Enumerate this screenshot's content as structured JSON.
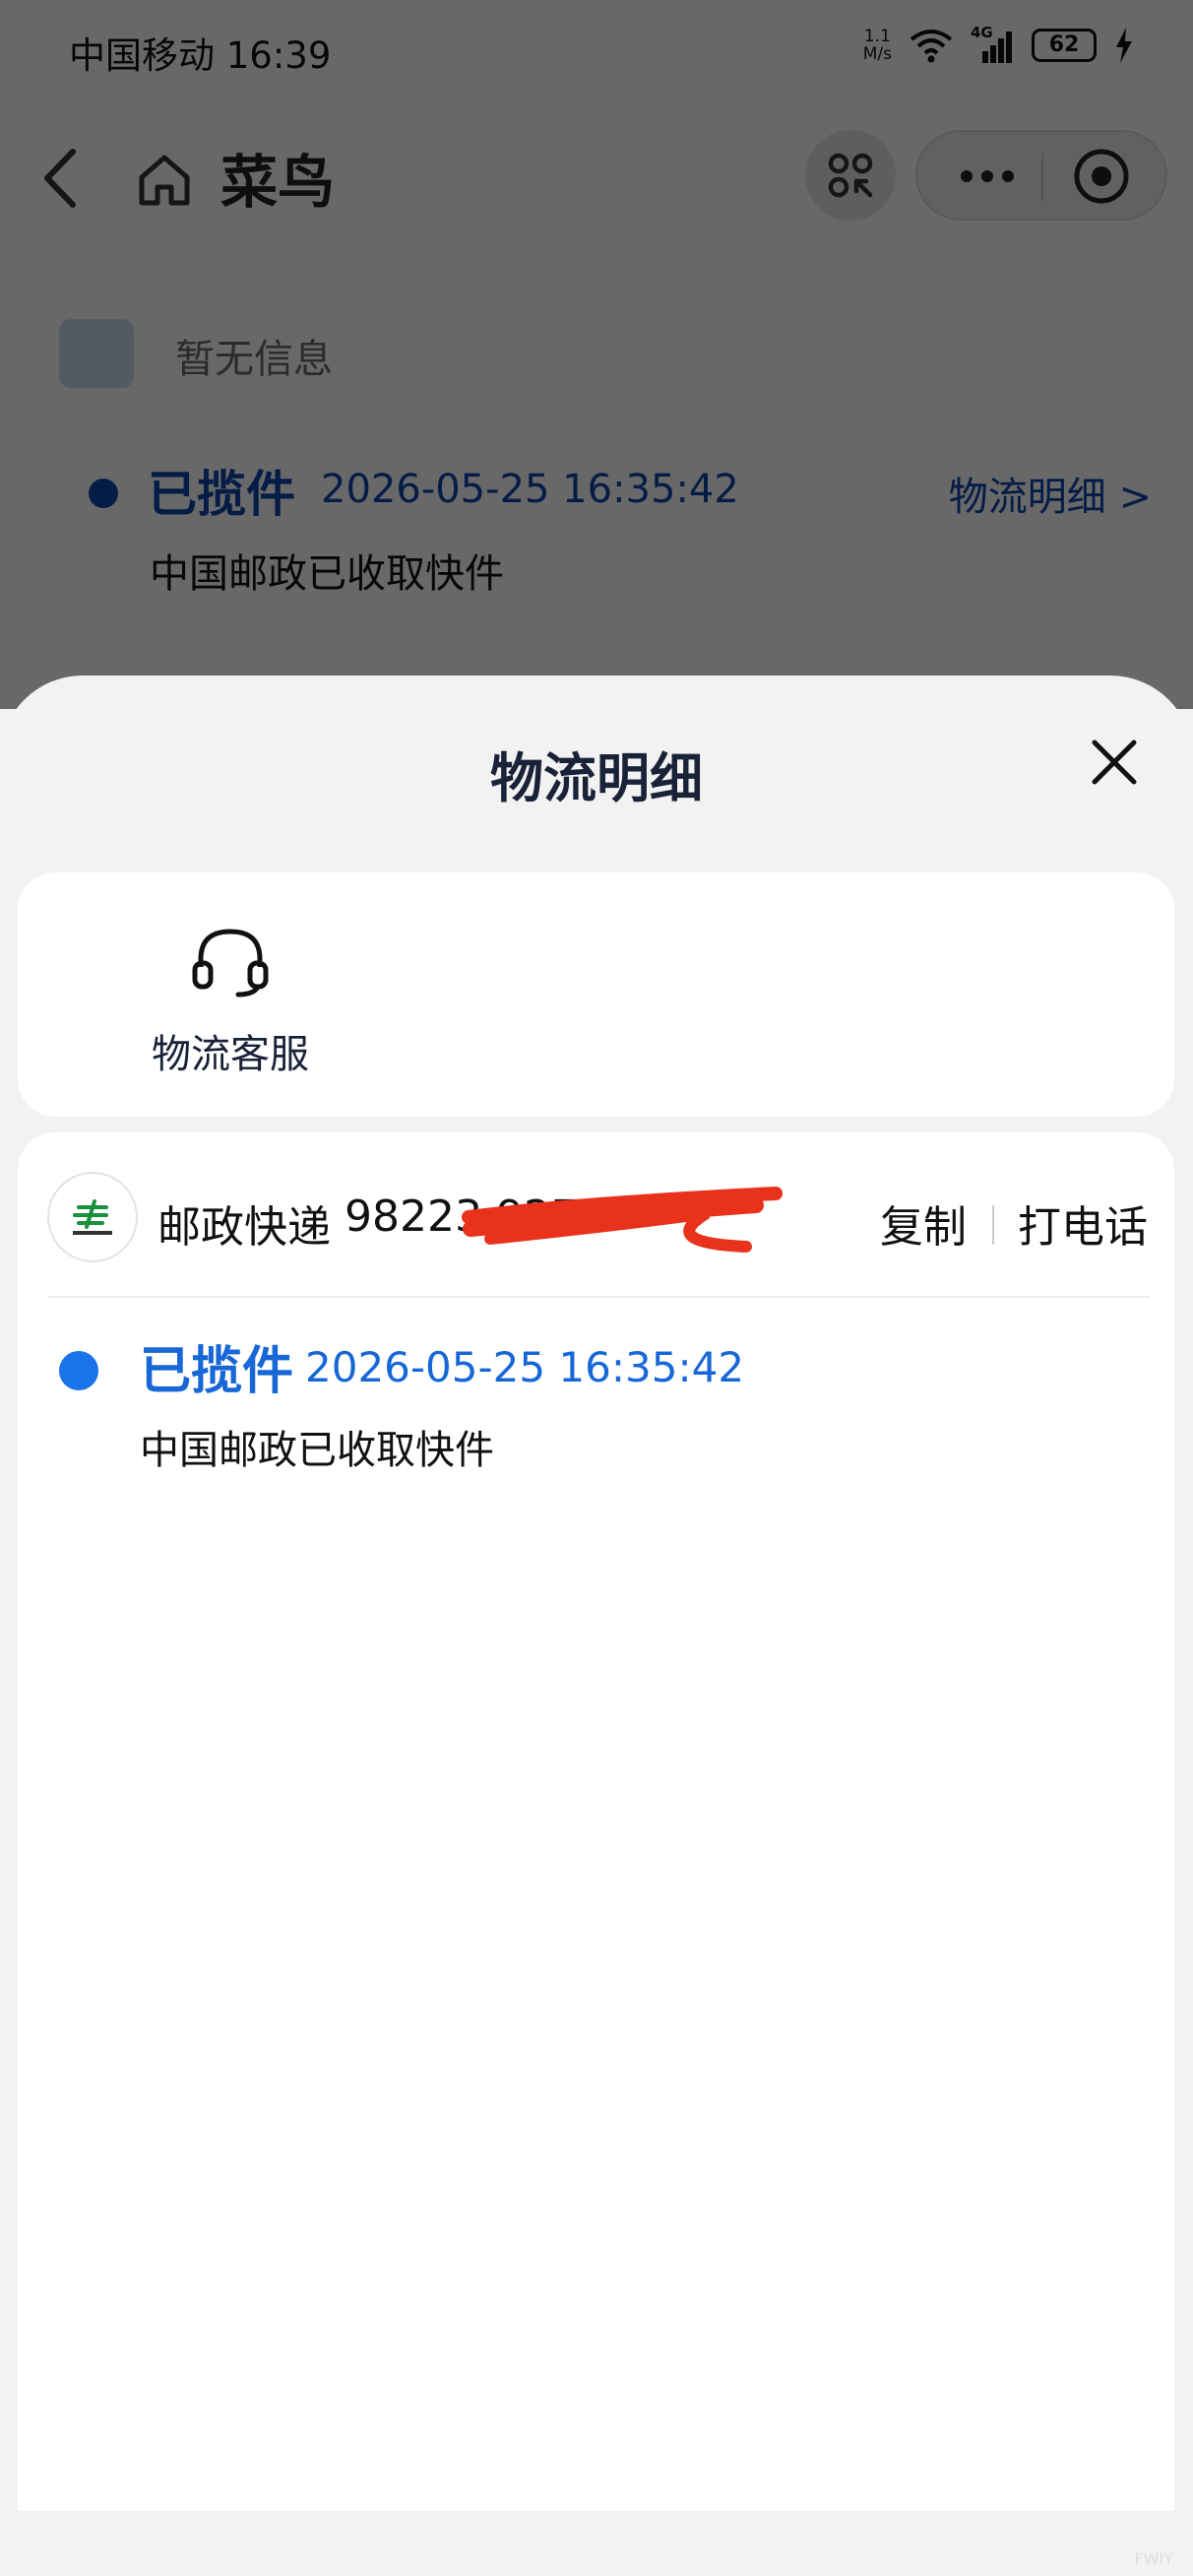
{
  "status_bar": {
    "carrier_time": "中国移动 16:39",
    "net_speed_value": "1.1",
    "net_speed_unit": "M/s",
    "network_type": "4G",
    "battery": "62"
  },
  "nav": {
    "title": "菜鸟"
  },
  "background": {
    "info_text": "暂无信息",
    "track_status": "已揽件",
    "track_time": "2026-05-25 16:35:42",
    "detail_link": "物流明细 >",
    "track_desc": "中国邮政已收取快件"
  },
  "sheet": {
    "title": "物流明细",
    "service": {
      "label": "物流客服"
    },
    "carrier": {
      "name": "邮政快递",
      "tracking_number_visible": "98223          927",
      "copy_label": "复制",
      "call_label": "打电话"
    },
    "events": [
      {
        "status": "已揽件",
        "time": "2026-05-25 16:35:42",
        "description": "中国邮政已收取快件"
      }
    ]
  },
  "colors": {
    "accent_blue": "#1767d6",
    "dark_blue": "#0e44a8",
    "redaction_red": "#e8321c",
    "title_color": "#1a2238"
  },
  "watermark": "FWIY"
}
